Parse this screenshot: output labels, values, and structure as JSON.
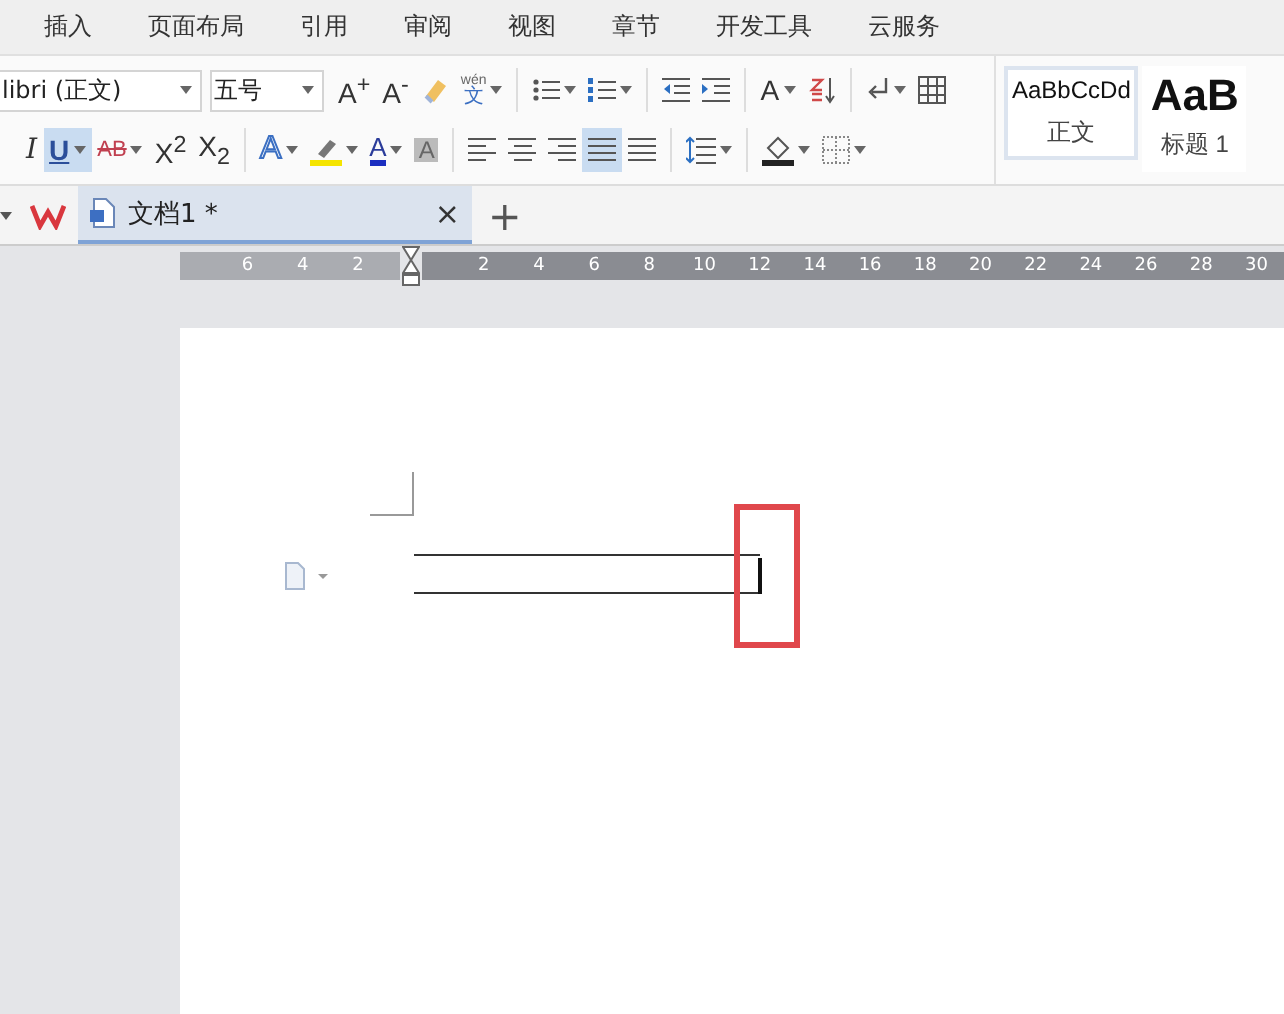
{
  "menu_tabs": [
    {
      "label": "插入"
    },
    {
      "label": "页面布局"
    },
    {
      "label": "引用"
    },
    {
      "label": "审阅"
    },
    {
      "label": "视图"
    },
    {
      "label": "章节"
    },
    {
      "label": "开发工具"
    },
    {
      "label": "云服务"
    }
  ],
  "font": {
    "family": "libri (正文)",
    "size": "五号"
  },
  "row1": [
    {
      "kind": "glyph",
      "label": "A$^{+}$",
      "caret": false,
      "selected": false
    },
    {
      "kind": "glyph",
      "label": "A$^{-}$",
      "caret": false,
      "selected": false
    },
    {
      "kind": "clear",
      "caret": false,
      "selected": false
    },
    {
      "kind": "pinyin",
      "label": "文",
      "ruby": "wén",
      "caret": true,
      "selected": false
    },
    {
      "kind": "separator"
    },
    {
      "kind": "bullets",
      "caret": true,
      "selected": false
    },
    {
      "kind": "numbering",
      "caret": true,
      "selected": false
    },
    {
      "kind": "separator"
    },
    {
      "kind": "outdent",
      "caret": false,
      "selected": false
    },
    {
      "kind": "indent",
      "caret": false,
      "selected": false
    },
    {
      "kind": "separator"
    },
    {
      "kind": "glyph",
      "label": "A",
      "caret": true,
      "selected": false
    },
    {
      "kind": "sort",
      "caret": false,
      "selected": false
    },
    {
      "kind": "separator"
    },
    {
      "kind": "marks",
      "caret": true,
      "selected": false
    },
    {
      "kind": "table",
      "caret": false,
      "selected": false
    }
  ],
  "row2": [
    {
      "kind": "italic-glyph",
      "label": "I",
      "caret": false,
      "selected": false
    },
    {
      "kind": "underline-glyph",
      "label": "U",
      "caret": true,
      "selected": true
    },
    {
      "kind": "strike-glyph",
      "label": "AB",
      "caret": true,
      "selected": false
    },
    {
      "kind": "glyph",
      "label": "X$^{2}$",
      "caret": false,
      "selected": false
    },
    {
      "kind": "glyph",
      "label": "X$_{2}$",
      "caret": false,
      "selected": false
    },
    {
      "kind": "separator"
    },
    {
      "kind": "outline-glyph",
      "label": "A",
      "caret": true,
      "selected": false
    },
    {
      "kind": "highlight",
      "caret": true,
      "selected": false
    },
    {
      "kind": "color-glyph",
      "label": "A",
      "caret": true,
      "selected": false
    },
    {
      "kind": "shaded-glyph",
      "label": "A",
      "caret": false,
      "selected": false
    },
    {
      "kind": "separator"
    },
    {
      "kind": "align-left",
      "caret": false,
      "selected": false
    },
    {
      "kind": "align-center",
      "caret": false,
      "selected": false
    },
    {
      "kind": "align-right",
      "caret": false,
      "selected": false
    },
    {
      "kind": "justify",
      "caret": false,
      "selected": true
    },
    {
      "kind": "distribute",
      "caret": false,
      "selected": false
    },
    {
      "kind": "separator"
    },
    {
      "kind": "line-spacing",
      "caret": true,
      "selected": false
    },
    {
      "kind": "separator"
    },
    {
      "kind": "shading",
      "caret": true,
      "selected": false
    },
    {
      "kind": "borders",
      "caret": true,
      "selected": false
    }
  ],
  "styles": [
    {
      "sample": "AaBbCcDd",
      "name": "正文",
      "selected": true
    },
    {
      "sample": "AaB",
      "name": "标题 1",
      "selected": false
    }
  ],
  "doc_tab": {
    "title": "文档1 *",
    "close": "×",
    "selected": true
  },
  "new_tab": "+",
  "ruler": {
    "left_numbers": [
      "6",
      "4",
      "2"
    ],
    "right_numbers": [
      "2",
      "4",
      "6",
      "8",
      "10",
      "12",
      "14",
      "16",
      "18",
      "20",
      "22",
      "24",
      "26",
      "28",
      "30"
    ]
  }
}
